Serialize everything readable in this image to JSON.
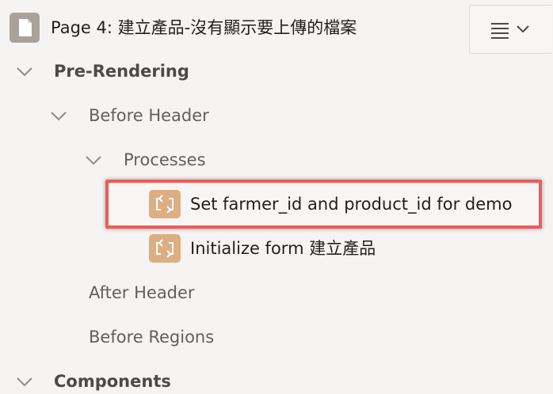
{
  "header": {
    "title": "Page 4: 建立產品-沒有顯示要上傳的檔案",
    "page_icon": "page-icon",
    "menu_icons": [
      "hamburger-icon",
      "chevron-down-icon"
    ]
  },
  "tree": {
    "pre_rendering": "Pre-Rendering",
    "before_header": "Before Header",
    "processes": "Processes",
    "process_items": [
      "Set farmer_id and product_id for demo",
      "Initialize form 建立產品"
    ],
    "after_header": "After Header",
    "before_regions": "Before Regions",
    "components": "Components"
  }
}
